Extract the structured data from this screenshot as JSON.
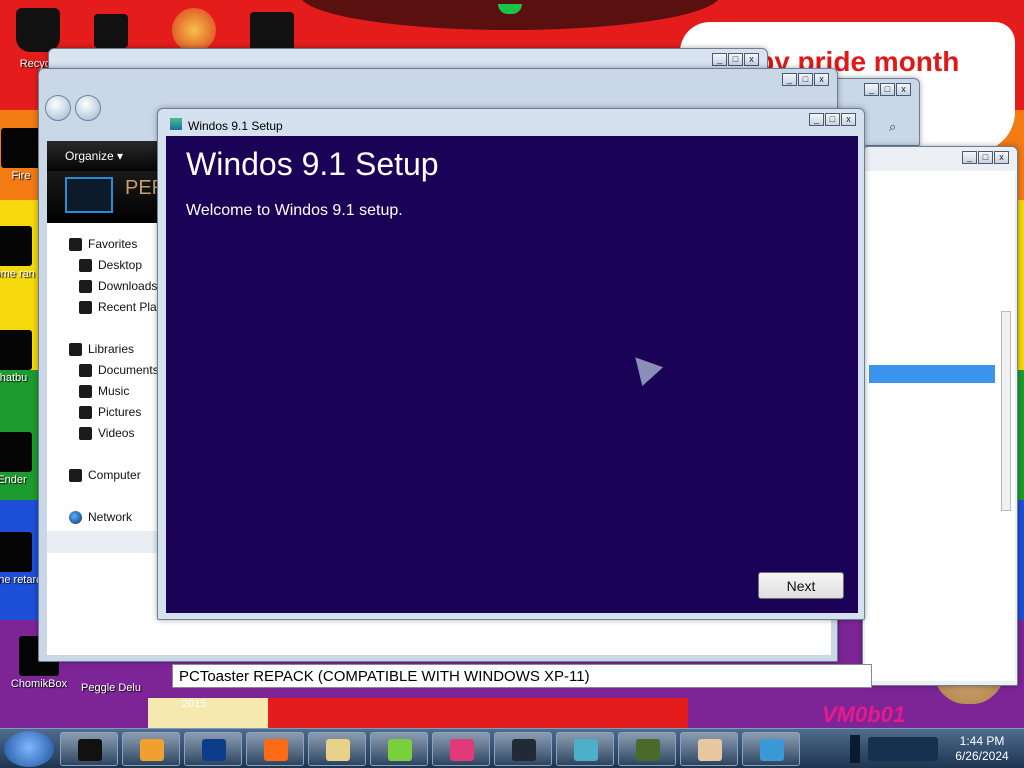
{
  "desktop": {
    "icons": [
      {
        "label": "Recyc"
      },
      {
        "label": "Fire"
      },
      {
        "label": "some ran"
      },
      {
        "label": "thatbu"
      },
      {
        "label": "Ender"
      },
      {
        "label": "none retard"
      },
      {
        "label": "ChomikBox"
      },
      {
        "label": "Peggle Delu"
      }
    ],
    "pride_text": "ppy pride month",
    "year_text": "2015",
    "vm_text": "VM0b01"
  },
  "explorer": {
    "organize_label": "Organize ▾",
    "banner_text": "PER",
    "nav": [
      {
        "label": "Favorites"
      },
      {
        "label": "Desktop"
      },
      {
        "label": "Downloads"
      },
      {
        "label": "Recent Plac"
      },
      {
        "label": "Libraries"
      },
      {
        "label": "Documents"
      },
      {
        "label": "Music"
      },
      {
        "label": "Pictures"
      },
      {
        "label": "Videos"
      },
      {
        "label": "Computer"
      },
      {
        "label": "Network"
      }
    ]
  },
  "setup": {
    "window_title": "Windos 9.1 Setup",
    "heading": "Windos 9.1 Setup",
    "welcome": "Welcome to Windos 9.1 setup.",
    "next_label": "Next"
  },
  "pctoaster": {
    "text": "PCToaster REPACK (COMPATIBLE WITH WINDOWS XP-11)"
  },
  "taskbar": {
    "time": "1:44 PM",
    "date": "6/26/2024",
    "buttons": [
      {
        "icon": "black-monitor-icon",
        "color": "#111111"
      },
      {
        "icon": "media-player-icon",
        "color": "#f0a030"
      },
      {
        "icon": "globe-icon",
        "color": "#0d3c8a"
      },
      {
        "icon": "firefox-icon",
        "color": "#ff6a14"
      },
      {
        "icon": "folder-icon",
        "color": "#e8d28a"
      },
      {
        "icon": "green-disc-icon",
        "color": "#7ad03a"
      },
      {
        "icon": "pink-app-icon",
        "color": "#e03a7a"
      },
      {
        "icon": "dark-window-icon",
        "color": "#222a36"
      },
      {
        "icon": "cube-icon",
        "color": "#4cb0c8"
      },
      {
        "icon": "minecraft-icon",
        "color": "#4a6a2a"
      },
      {
        "icon": "user-icon",
        "color": "#e8c8a0"
      },
      {
        "icon": "setup-app-icon",
        "color": "#3a9ad8"
      }
    ]
  }
}
